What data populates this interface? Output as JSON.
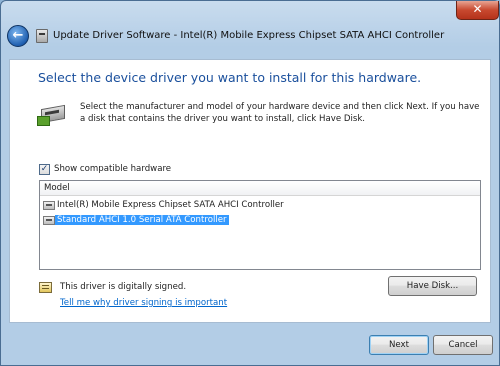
{
  "window": {
    "title": "Update Driver Software - Intel(R) Mobile Express Chipset SATA AHCI Controller",
    "back_glyph": "←",
    "close_glyph": "✕"
  },
  "main": {
    "heading": "Select the device driver you want to install for this hardware.",
    "instructions": "Select the manufacturer and model of your hardware device and then click Next. If you have a disk that contains the driver you want to install, click Have Disk.",
    "show_compatible": {
      "label": "Show compatible hardware",
      "checked": true,
      "glyph": "✓"
    },
    "model_list": {
      "header": "Model",
      "items": [
        {
          "label": "Intel(R) Mobile Express Chipset SATA AHCI Controller",
          "selected": false
        },
        {
          "label": "Standard AHCI 1.0 Serial ATA Controller",
          "selected": true
        }
      ]
    },
    "signature": {
      "status": "This driver is digitally signed.",
      "link": "Tell me why driver signing is important"
    },
    "have_disk_label": "Have Disk..."
  },
  "footer": {
    "next_label": "Next",
    "cancel_label": "Cancel"
  },
  "colors": {
    "heading": "#1a4f9c",
    "link": "#0066cc",
    "selection": "#3399ff"
  }
}
